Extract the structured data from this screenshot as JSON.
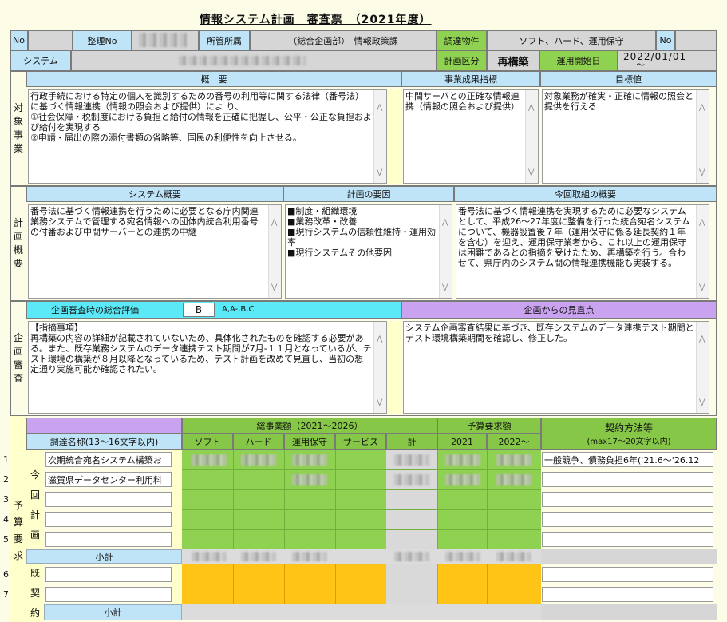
{
  "title": "情報システム計画　審査票　（2021年度）",
  "header": {
    "no_label": "No",
    "seiri_no_label": "整理No",
    "shokan_label": "所管所属",
    "shokan_value": "（総合企画部）　情報政策課",
    "chotatsu_label": "調達物件",
    "chotatsu_value": "ソフト、ハード、運用保守",
    "no2_label": "No",
    "system_label": "システム",
    "keikaku_kubun_label": "計画区分",
    "keikaku_kubun_value": "再構築",
    "unyou_label": "運用開始日",
    "unyou_value": "2022/01/01",
    "unyou_tilde": "～"
  },
  "taisho": {
    "side_label": [
      "対",
      "象",
      "事",
      "業"
    ],
    "gaiyou_header": "概　要",
    "gaiyou_text": "行政手続における特定の個人を識別するための番号の利用等に関する法律（番号法）に基づく情報連携（情報の照会および提供）によ り、\n①社会保障・税制度における負担と給付の情報を正確に把握し、公平・公正な負担および給付を実現する\n②申請・届出の際の添付書類の省略等、国民の利便性を向上させる。",
    "seika_header": "事業成果指標",
    "seika_text": "中間サーバとの正確な情報連携（情報の照会および提供）",
    "mokuhyou_header": "目標値",
    "mokuhyou_text": "対象業務が確実・正確に情報の照会と提供を行える"
  },
  "keikaku": {
    "side_label": [
      "計",
      "画",
      "概",
      "要"
    ],
    "system_header": "システム概要",
    "system_text": "番号法に基づく情報連携を行うために必要となる庁内関連業務システムで管理する宛名情報への団体内統合利用番号の付番および中間サーバーとの連携の中継",
    "youin_header": "計画の要因",
    "youin_text": "■制度・組織環境\n■業務改革・改善\n■現行システムの信頼性維持・運用効率\n■現行システムその他要因",
    "konkai_header": "今回取組の概要",
    "konkai_text": "番号法に基づく情報連携を実現するために必要なシステムとして、平成26～27年度に整備を行った統合宛名システムについて、機器設置後７年（運用保守に係る延長契約１年を含む）を迎え、運用保守業者から、これ以上の運用保守は困難であるとの指摘を受けたため、再構築を行う。合わせて、県庁内のシステム間の情報連携機能も実装する。"
  },
  "kikaku": {
    "side_label": [
      "企",
      "画",
      "審",
      "査"
    ],
    "hyouka_header": "企画審査時の総合評価",
    "hyouka_value": "B",
    "hyouka_scale": "A,A-,B,C",
    "minaoshi_header": "企画からの見直点",
    "shiteki_text": "【指摘事項】\n再構築の内容の詳細が記載されていないため、具体化されたものを確認する必要がある。また、既存業務システムのデータ連携テスト期間が7月-１１月となっているが、テスト環境の構築が８月以降となっているため、テスト計画を改めて見直し、当初の想定通り実施可能か確認されたい。",
    "minaoshi_text": "システム企画審査結果に基づき、既存システムのデータ連携テスト期間とテスト環境構築期間を確認し、修正した。"
  },
  "yosan": {
    "side_label": [
      "予",
      "算",
      "要",
      "求"
    ],
    "chotatsu_header": "調達名称(13～16文字以内)",
    "sou_header": "総事業額（2021～2026）",
    "cols": [
      "ソフト",
      "ハード",
      "運用保守",
      "サービス",
      "計"
    ],
    "yosan_header": "予算要求額",
    "years": [
      "2021",
      "2022～"
    ],
    "keiyaku_header": "契約方法等",
    "keiyaku_sub": "(max17～20文字以内)",
    "kon_label": [
      "今",
      "回",
      "計",
      "画"
    ],
    "ki_label": [
      "既",
      "契",
      "約"
    ],
    "row_numbers": [
      "1",
      "2",
      "3",
      "4",
      "5",
      "6",
      "7"
    ],
    "rows": [
      {
        "name": "次期統合宛名システム構築お",
        "keiyaku": "一般競争、債務負担6年('21.6～'26.12"
      },
      {
        "name": "滋賀県データセンター利用料",
        "keiyaku": ""
      },
      {
        "name": "",
        "keiyaku": ""
      },
      {
        "name": "",
        "keiyaku": ""
      },
      {
        "name": "",
        "keiyaku": ""
      }
    ],
    "subtotal_label": "小計",
    "subtotal2_label": "小計"
  }
}
